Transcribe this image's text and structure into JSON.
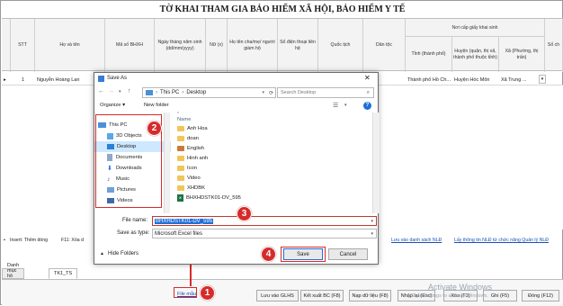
{
  "form": {
    "title": "TỜ KHAI THAM GIA BẢO HIỂM XÃ HỘI, BẢO HIỂM Y TẾ",
    "columns": [
      "STT",
      "Họ và tên",
      "Mã số BHXH",
      "Ngày tháng năm sinh (dd/mm/yyyy)",
      "Nữ (x)",
      "Họ tên cha/mẹ/ người giám hộ",
      "Số điện thoại liên hệ",
      "Quốc tịch",
      "Dân tộc"
    ],
    "group_header": "Nơi cấp giấy khai sinh",
    "group_columns": [
      "Tỉnh (thành phố)",
      "Huyện (quận, thị xã, thành phố thuộc tỉnh)",
      "Xã (Phường, thị trấn)"
    ],
    "extra_column": "Số ch",
    "row": {
      "num": "1",
      "name": "Nguyễn Hoàng Lan",
      "province": "Thành phố Hồ Ch...",
      "district": "Huyện Hóc Môn",
      "ward": "Xã Trung ..."
    }
  },
  "statusbar": {
    "insert_hint": "Insert: Thêm dòng",
    "f11_hint": "F11: Xóa d",
    "link1": "Lưu vào danh sách NLĐ",
    "link2": "Lấy thông tin NLĐ từ chức năng Quản lý NLĐ"
  },
  "tabs": [
    "Danh mục hồ sơ",
    "TK1_TS"
  ],
  "bottom": {
    "file_link": "File mẫu",
    "buttons": [
      "Lưu vào GLHS",
      "Kết xuất BC (F8)",
      "Nạp dữ liệu (F8)",
      "Nhập lại (Esc)",
      "Xóa (F3)",
      "Ghi (F5)",
      "Đóng (F12)"
    ]
  },
  "watermark": {
    "line1": "Activate Windows",
    "line2": "Go to Settings to activate Windows."
  },
  "dialog": {
    "title": "Save As",
    "path": [
      "This PC",
      "Desktop"
    ],
    "search_placeholder": "Search Desktop",
    "organize": "Organize ▾",
    "new_folder": "New folder",
    "nav_items": [
      "This PC",
      "3D Objects",
      "Desktop",
      "Documents",
      "Downloads",
      "Music",
      "Pictures",
      "Videos"
    ],
    "name_header": "Name",
    "files": [
      "Anh Hoa",
      "doan",
      "English",
      "Hinh anh",
      "Icon",
      "Video",
      "XHDBK",
      "BHXHDSTK01-DV_595"
    ],
    "file_name_label": "File name:",
    "file_name_value": "BHXHDSTK01-DV_595",
    "save_type_label": "Save as type:",
    "save_type_value": "Microsoft Excel files",
    "hide_folders": "Hide Folders",
    "save": "Save",
    "cancel": "Cancel"
  },
  "callouts": [
    "1",
    "2",
    "3",
    "4"
  ],
  "colors": {
    "accent": "#d62b2b",
    "link": "#1a4fb5",
    "selection": "#cde8ff"
  }
}
